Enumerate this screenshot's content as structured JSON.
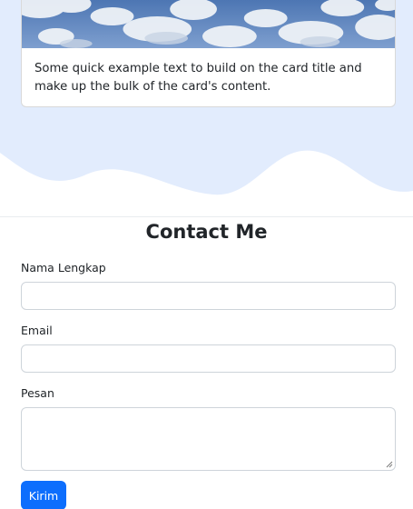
{
  "projects": {
    "card": {
      "image_name": "clouds-sky-image",
      "text": "Some quick example text to build on the card title and make up the bulk of the card's content."
    }
  },
  "contact": {
    "title": "Contact Me",
    "fields": {
      "name_label": "Nama Lengkap",
      "name_value": "",
      "email_label": "Email",
      "email_value": "",
      "message_label": "Pesan",
      "message_value": ""
    },
    "submit_label": "Kirim"
  },
  "colors": {
    "section_bg": "#e2ecfd",
    "primary_button": "#0d6efd",
    "text": "#212529"
  }
}
